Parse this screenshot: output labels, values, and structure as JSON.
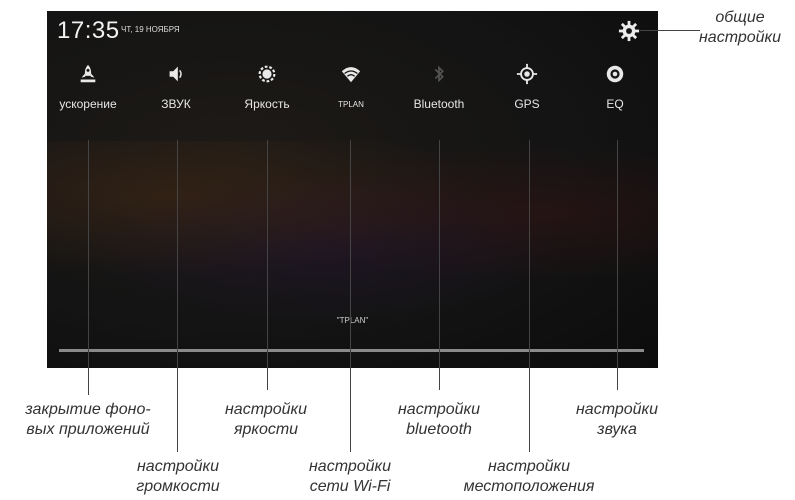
{
  "status": {
    "time": "17:35",
    "date": "ЧТ, 19 НОЯБРЯ"
  },
  "tiles": [
    {
      "label": "ускорение",
      "icon": "rocket-icon"
    },
    {
      "label": "ЗВУК",
      "icon": "volume-icon"
    },
    {
      "label": "Яркость",
      "icon": "brightness-icon"
    },
    {
      "label": "TPLAN",
      "icon": "wifi-icon"
    },
    {
      "label": "Bluetooth",
      "icon": "bluetooth-icon"
    },
    {
      "label": "GPS",
      "icon": "gps-icon"
    },
    {
      "label": "EQ",
      "icon": "eq-icon"
    }
  ],
  "settings_icon": "gear-icon",
  "network_ssid": "\"TPLAN\"",
  "captions": {
    "general": "общие\nнастройки",
    "boost": "закрытие фоно-\nвых приложений",
    "volume": "настройки\nгромкости",
    "brightness": "настройки\nяркости",
    "wifi": "настройки\nсети Wi-Fi",
    "bluetooth": "настройки\nbluetooth",
    "location": "настройки\nместоположения",
    "sound": "настройки\nзвука"
  }
}
